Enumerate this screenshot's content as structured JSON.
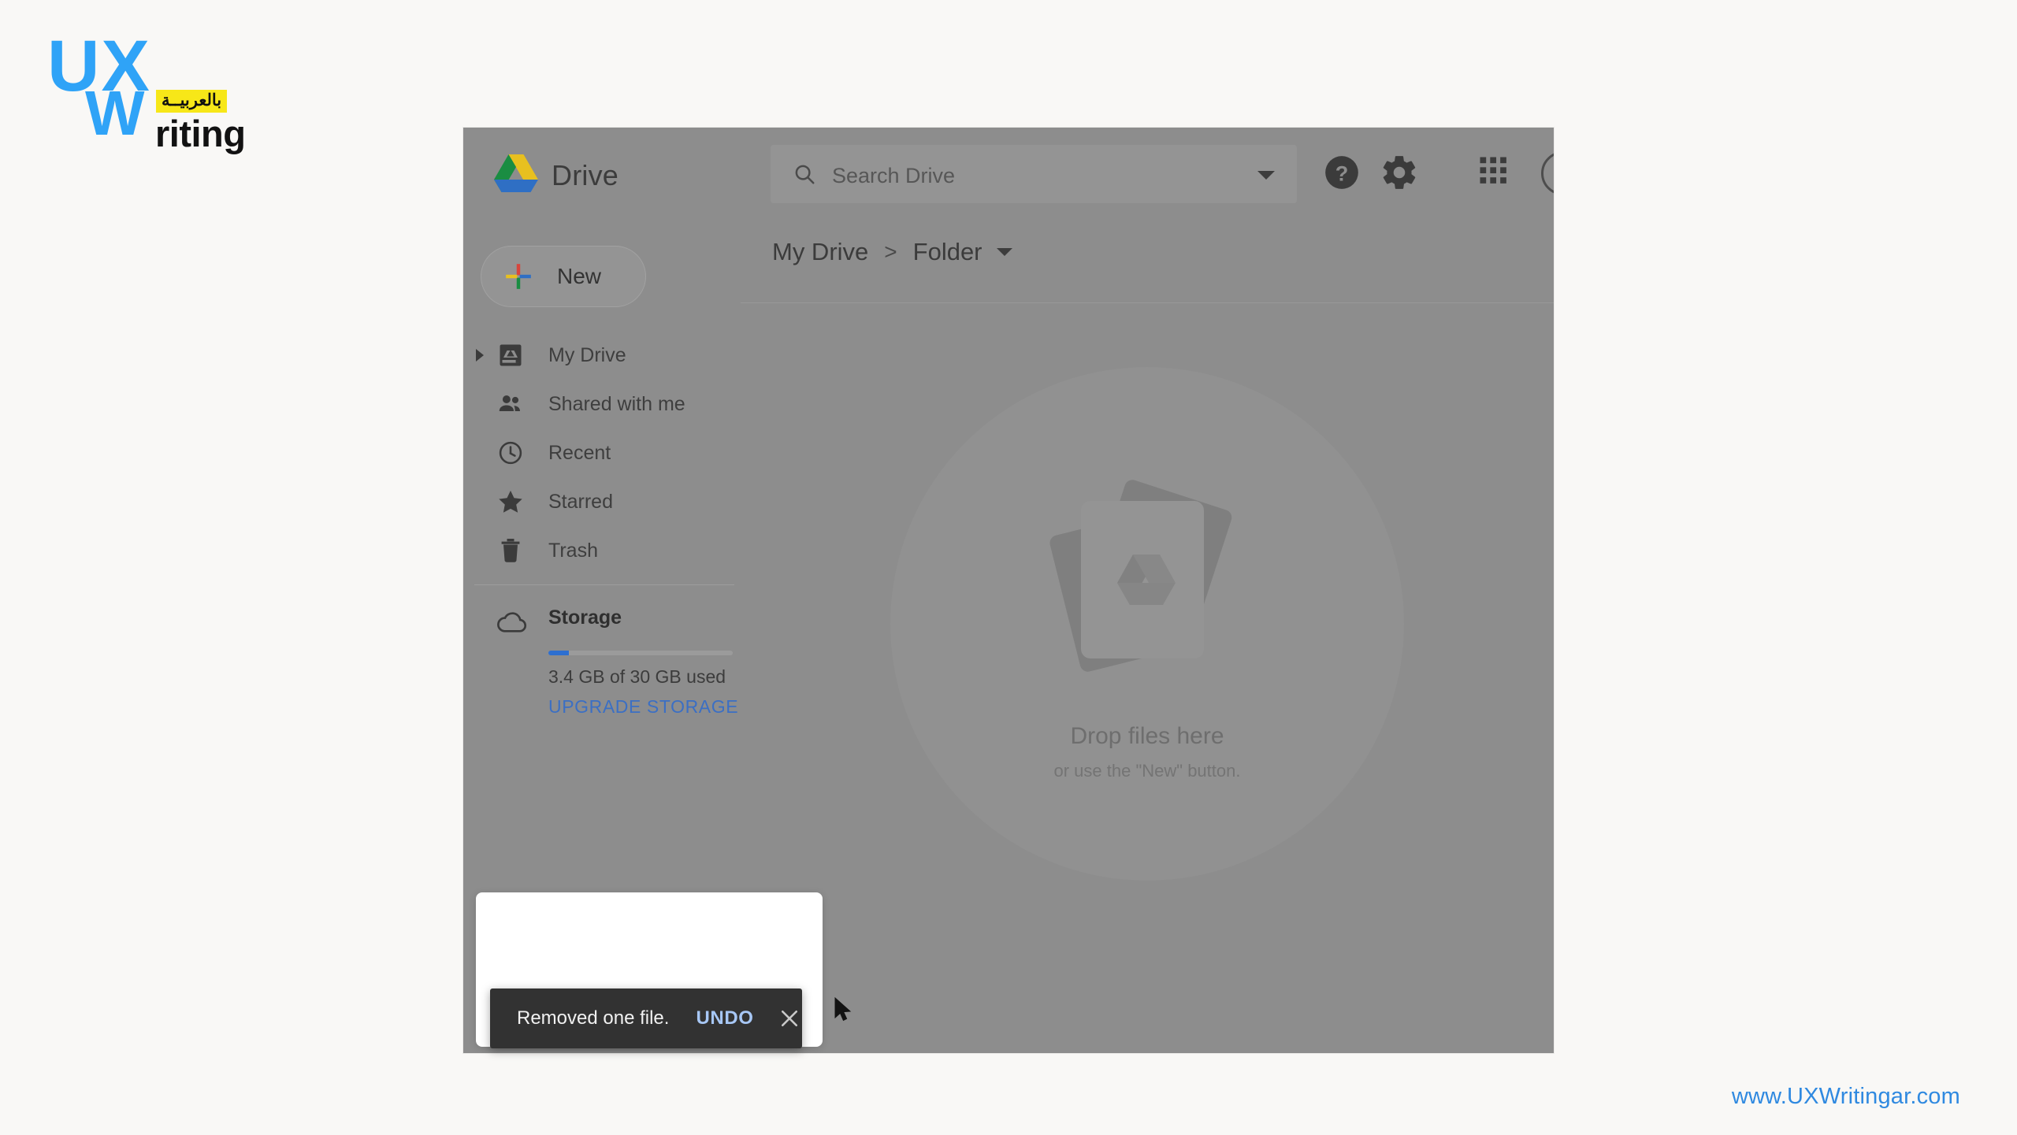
{
  "brand": {
    "ux": "UX",
    "w": "W",
    "arabic_badge": "بالعربيــة",
    "riting": "riting"
  },
  "drive": {
    "header": {
      "title": "Drive",
      "logo_icon": "google-drive-logo-icon",
      "search": {
        "placeholder": "Search Drive",
        "value": "",
        "icon": "search-icon",
        "caret_icon": "chevron-down-icon"
      },
      "help_icon": "help-circle-icon",
      "settings_icon": "gear-icon",
      "apps_icon": "apps-grid-icon",
      "avatar_label": "account-avatar"
    },
    "sidebar": {
      "new_button": {
        "label": "New",
        "icon": "plus-multicolor-icon"
      },
      "items": [
        {
          "label": "My Drive",
          "icon": "hard-drive-icon",
          "expandable": true
        },
        {
          "label": "Shared with me",
          "icon": "people-icon",
          "expandable": false
        },
        {
          "label": "Recent",
          "icon": "clock-icon",
          "expandable": false
        },
        {
          "label": "Starred",
          "icon": "star-icon",
          "expandable": false
        },
        {
          "label": "Trash",
          "icon": "trash-icon",
          "expandable": false
        }
      ],
      "storage": {
        "label": "Storage",
        "icon": "cloud-icon",
        "used_text": "3.4 GB of 30 GB used",
        "percent_used": 11,
        "upgrade_label": "UPGRADE STORAGE",
        "upgrade_color": "#3b6fc4",
        "bar_color": "#2d6fd0"
      }
    },
    "breadcrumb": {
      "root": "My Drive",
      "separator": ">",
      "current": "Folder",
      "caret_icon": "chevron-down-icon"
    },
    "empty_state": {
      "title": "Drop files here",
      "subtitle": "or use the \"New\" button.",
      "art_icon": "stacked-files-drive-icon"
    },
    "toast": {
      "message": "Removed one file.",
      "undo_label": "UNDO",
      "undo_color": "#a7c7f5",
      "close_icon": "close-icon",
      "background": "#323232"
    }
  },
  "cursor": {
    "icon": "mouse-pointer-icon"
  },
  "footer": {
    "url": "www.UXWritingar.com",
    "color": "#2f89e0"
  }
}
